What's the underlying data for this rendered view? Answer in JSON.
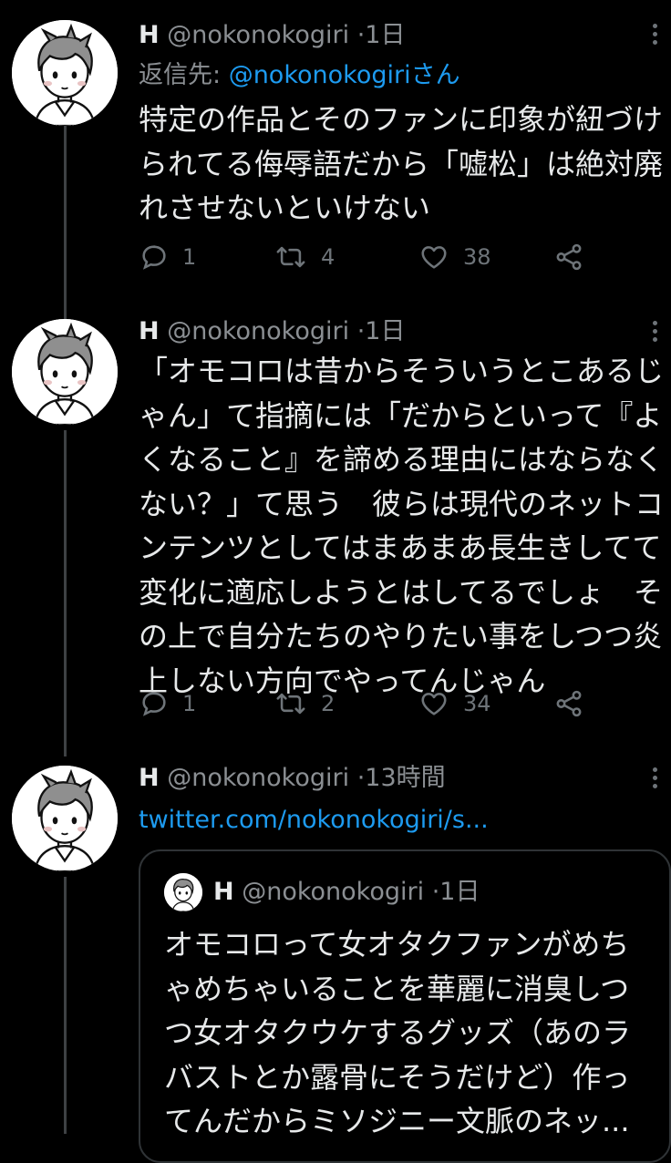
{
  "tweets": [
    {
      "name": "H",
      "handle": "@nokonokogiri",
      "dot": "·",
      "time": "1日",
      "reply_prefix": "返信先: ",
      "reply_handle": "@nokonokogiriさん",
      "text": "特定の作品とそのファンに印象が紐づけ\nられてる侮辱語だから「嘘松」は絶対廃\nれさせないといけない",
      "replies": "1",
      "retweets": "4",
      "likes": "38"
    },
    {
      "name": "H",
      "handle": "@nokonokogiri",
      "dot": "·",
      "time": "1日",
      "text": "「オモコロは昔からそういうとこあるじ\nゃん」て指摘には「だからといって『よ\nくなること』を諦める理由にはならなく\nない？」て思う　彼らは現代のネットコ\nンテンツとしてはまあまあ長生きしてて\n変化に適応しようとはしてるでしょ　そ\nの上で自分たちのやりたい事をしつつ炎\n上しない方向でやってんじゃん",
      "replies": "1",
      "retweets": "2",
      "likes": "34"
    },
    {
      "name": "H",
      "handle": "@nokonokogiri",
      "dot": "·",
      "time": "13時間",
      "link": "twitter.com/nokonokogiri/s...",
      "quote": {
        "name": "H",
        "handle": "@nokonokogiri",
        "dot": "·",
        "time": "1日",
        "text": "オモコロって女オタクファンがめち\nゃめちゃいることを華麗に消臭しつ\nつ女オタクウケするグッズ（あのラ\nバストとか露骨にそうだけど）作っ\nてんだからミソジニー文脈のネッ..."
      }
    }
  ],
  "icons": {
    "reply": "reply-icon",
    "retweet": "retweet-icon",
    "like": "heart-icon",
    "share": "share-icon",
    "more": "more-icon"
  },
  "colors": {
    "background": "#000000",
    "text": "#e7e9ea",
    "secondary": "#8b8f93",
    "link": "#1d9bf0",
    "thread_line": "#3e4144"
  }
}
